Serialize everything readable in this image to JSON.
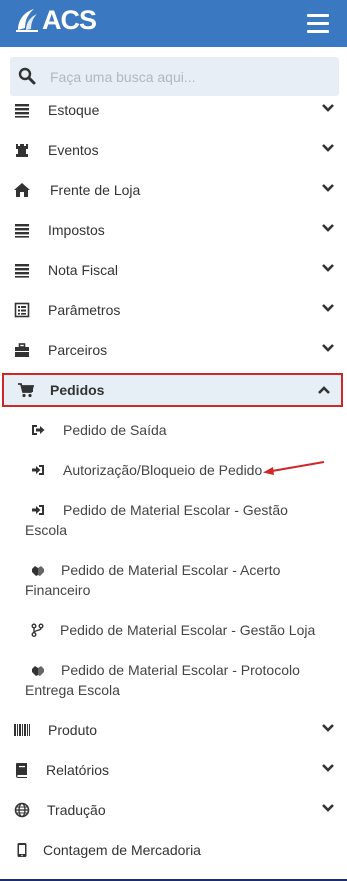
{
  "header": {
    "logo_text": "ACS",
    "menu_icon": "hamburger-icon",
    "color": "#3a78c2"
  },
  "search": {
    "placeholder": "Faça uma busca aqui...",
    "icon": "search-icon"
  },
  "menu": [
    {
      "label": "Estoque",
      "icon": "list-icon"
    },
    {
      "label": "Eventos",
      "icon": "chess-rook-icon"
    },
    {
      "label": "Frente de Loja",
      "icon": "home-icon"
    },
    {
      "label": "Impostos",
      "icon": "list-icon"
    },
    {
      "label": "Nota Fiscal",
      "icon": "list-icon"
    },
    {
      "label": "Parâmetros",
      "icon": "list-alt-icon"
    },
    {
      "label": "Parceiros",
      "icon": "briefcase-icon"
    },
    {
      "label": "Pedidos",
      "icon": "cart-icon",
      "expanded": true
    },
    {
      "label": "Produto",
      "icon": "barcode-icon"
    },
    {
      "label": "Relatórios",
      "icon": "book-icon"
    },
    {
      "label": "Tradução",
      "icon": "globe-icon"
    },
    {
      "label": "Contagem de Mercadoria",
      "icon": "mobile-icon"
    }
  ],
  "pedidos_submenu": [
    {
      "label": "Pedido de Saída",
      "icon": "sign-out-icon"
    },
    {
      "label": "Autorização/Bloqueio de Pedido",
      "icon": "sign-in-icon"
    },
    {
      "label": "Pedido de Material Escolar - Gestão Escola",
      "icon": "sign-in-icon"
    },
    {
      "label": "Pedido de Material Escolar - Acerto Financeiro",
      "icon": "handshake-icon"
    },
    {
      "label": "Pedido de Material Escolar - Gestão Loja",
      "icon": "code-fork-icon"
    },
    {
      "label": "Pedido de Material Escolar - Protocolo Entrega Escola",
      "icon": "handshake-icon"
    }
  ],
  "colors": {
    "highlight_border": "#d0262a",
    "highlight_bg": "#e6eef6",
    "annotation_arrow": "#d0262a"
  }
}
